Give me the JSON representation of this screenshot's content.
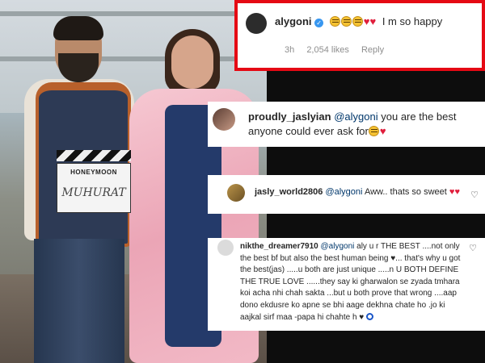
{
  "photo": {
    "clapboard_title": "HONEYMOON",
    "clapboard_text": "MUHURAT"
  },
  "comments": [
    {
      "username": "alygoni",
      "verified": true,
      "text": "I m so happy",
      "time": "3h",
      "likes": "2,054 likes",
      "reply": "Reply",
      "highlighted": true
    },
    {
      "username": "proudly_jaslyian",
      "mention": "@alygoni",
      "text": "you are the best anyone could ever ask for"
    },
    {
      "username": "jasly_world2806",
      "mention": "@alygoni",
      "text": "Aww.. thats so sweet"
    },
    {
      "username": "nikthe_dreamer7910",
      "mention": "@alygoni",
      "text": "aly u r THE BEST ....not only the best bf but also the best human being ♥... that's why u got the best(jas) .....u both are just unique .....n U BOTH DEFINE THE TRUE LOVE ......they say ki gharwalon se zyada tmhara koi acha nhi chah sakta ...but u both prove that wrong ....aap dono ekdusre ko apne se bhi aage dekhna chate ho .jo ki aajkal sirf maa -papa hi chahte h ♥"
    }
  ],
  "colors": {
    "highlight_border": "#e50914",
    "mention": "#00376b",
    "heart": "#e01e3c",
    "verified": "#3897f0"
  },
  "icons": [
    "verified-badge-icon",
    "heart-icon",
    "emoji-icon",
    "like-heart-icon",
    "circle-icon"
  ]
}
